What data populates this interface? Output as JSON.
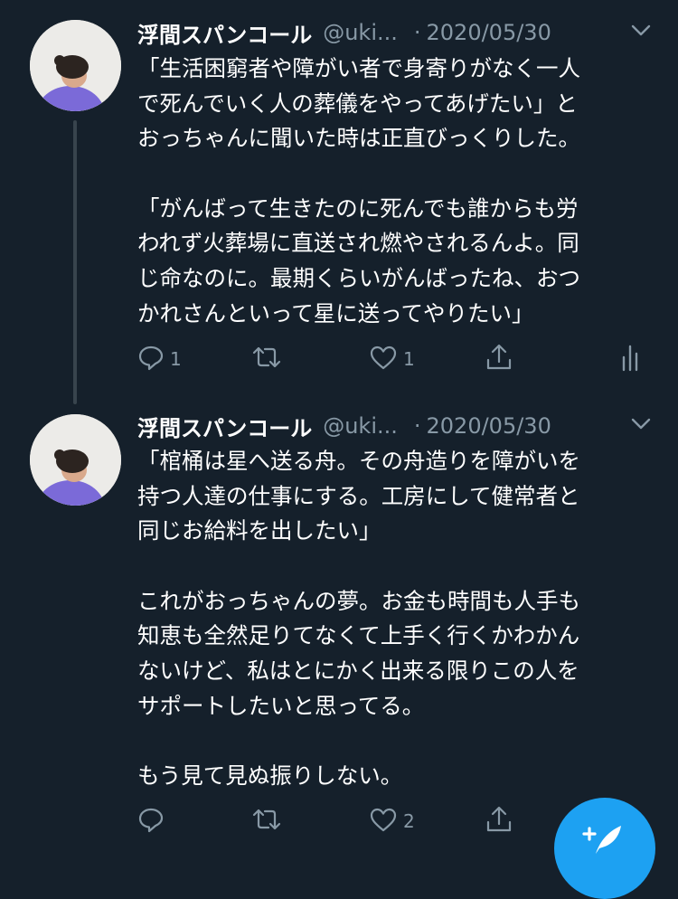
{
  "tweets": [
    {
      "name": "浮間スパンコール",
      "handle": "@uki...",
      "separator": "·",
      "date": "2020/05/30",
      "lines": [
        "「生活困窮者や障がい者で身寄りがなく一人",
        "で死んでいく人の葬儀をやってあげたい」と",
        "おっちゃんに聞いた時は正直びっくりした。",
        "",
        "「がんばって生きたのに死んでも誰からも労",
        "われず火葬場に直送され燃やされるんよ。同",
        "じ命なのに。最期くらいがんばったね、おつ",
        "かれさんといって星に送ってやりたい」"
      ],
      "reply_count": "1",
      "retweet_count": "",
      "like_count": "1"
    },
    {
      "name": "浮間スパンコール",
      "handle": "@uki...",
      "separator": "·",
      "date": "2020/05/30",
      "lines": [
        "「棺桶は星へ送る舟。その舟造りを障がいを",
        "持つ人達の仕事にする。工房にして健常者と",
        "同じお給料を出したい」",
        "",
        "これがおっちゃんの夢。お金も時間も人手も",
        "知恵も全然足りてなくて上手く行くかわかん",
        "ないけど、私はとにかく出来る限りこの人を",
        "サポートしたいと思ってる。",
        "",
        "もう見て見ぬ振りしない。"
      ],
      "reply_count": "",
      "retweet_count": "",
      "like_count": "2"
    }
  ],
  "icons": {
    "reply": "reply-icon",
    "retweet": "retweet-icon",
    "like": "like-icon",
    "share": "share-icon",
    "analytics": "analytics-icon",
    "caret": "chevron-down-icon",
    "compose": "compose-tweet-icon"
  },
  "colors": {
    "background": "#15202b",
    "secondary_text": "#8899a6",
    "accent": "#1da1f2"
  }
}
